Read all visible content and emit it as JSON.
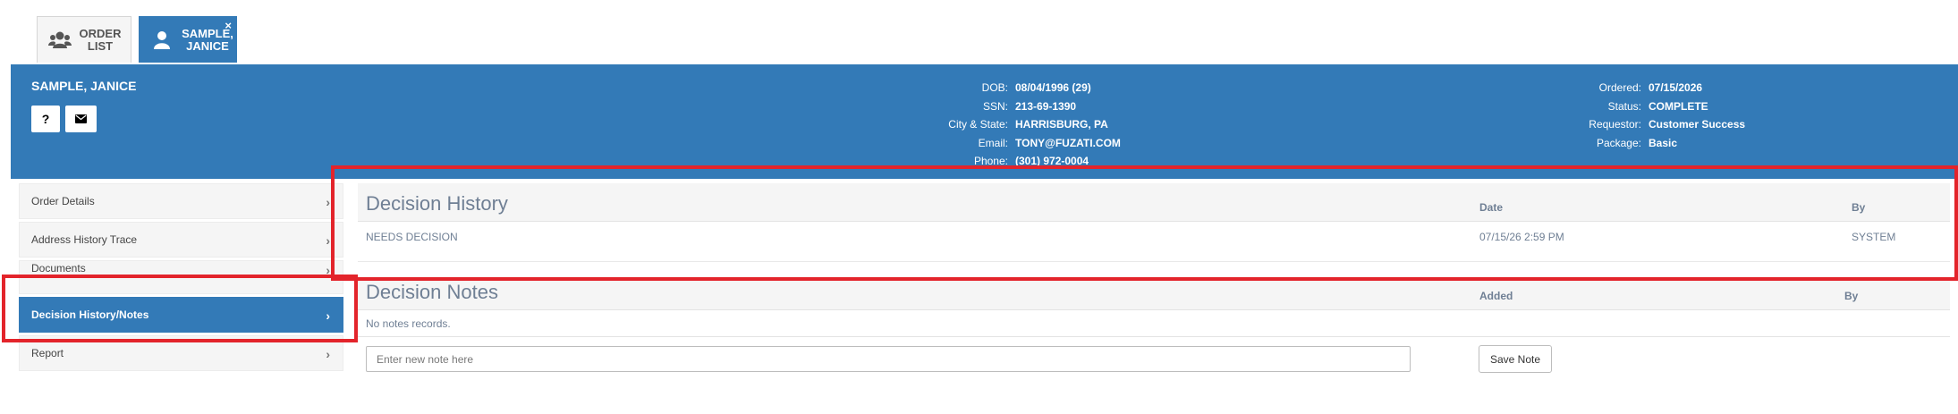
{
  "tabs": {
    "order_list": "ORDER LIST",
    "patient": "SAMPLE, JANICE",
    "close": "×"
  },
  "header": {
    "name": "SAMPLE, JANICE",
    "help_btn": "?",
    "mail_icon": "envelope-icon",
    "center": [
      {
        "label": "DOB:",
        "value": "08/04/1996 (29)"
      },
      {
        "label": "SSN:",
        "value": "213-69-1390"
      },
      {
        "label": "City & State:",
        "value": "HARRISBURG, PA"
      },
      {
        "label": "Email:",
        "value": "TONY@FUZATI.COM"
      },
      {
        "label": "Phone:",
        "value": "(301) 972-0004"
      }
    ],
    "right": [
      {
        "label": "Ordered:",
        "value": "07/15/2026"
      },
      {
        "label": "Status:",
        "value": "COMPLETE"
      },
      {
        "label": "Requestor:",
        "value": "Customer Success"
      },
      {
        "label": "Package:",
        "value": "Basic"
      }
    ]
  },
  "sidebar": {
    "items": [
      {
        "label": "Order Details"
      },
      {
        "label": "Address History Trace"
      },
      {
        "label": "Documents"
      },
      {
        "label": "Decision History/Notes"
      },
      {
        "label": "Report"
      }
    ],
    "chevron": "›"
  },
  "decision_history": {
    "title": "Decision History",
    "col_date": "Date",
    "col_by": "By",
    "rows": [
      {
        "decision": "NEEDS DECISION",
        "date": "07/15/26 2:59 PM",
        "by": "SYSTEM"
      }
    ]
  },
  "decision_notes": {
    "title": "Decision Notes",
    "col_added": "Added",
    "col_by": "By",
    "empty": "No notes records.",
    "input_placeholder": "Enter new note here",
    "save_label": "Save Note"
  },
  "colors": {
    "primary": "#337ab7",
    "highlight": "#e3242b",
    "muted_text": "#6f7f94"
  }
}
